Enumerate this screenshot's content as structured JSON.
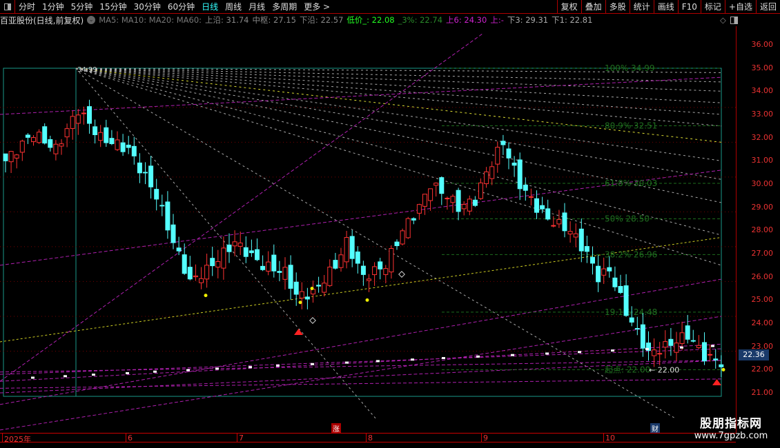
{
  "periods": [
    "分时",
    "1分钟",
    "5分钟",
    "15分钟",
    "30分钟",
    "60分钟",
    "日线",
    "周线",
    "月线",
    "多周期",
    "更多 >"
  ],
  "active_period": "日线",
  "right_buttons": [
    "复权",
    "叠加",
    "多股",
    "统计",
    "画线",
    "F10",
    "标记",
    "+自选",
    "返回"
  ],
  "info": {
    "stock": "百亚股份(日线,前复权)",
    "ma": "MA5: MA10: MA20: MA60:",
    "upper": "上沿: 31.74",
    "mid": "中枢: 27.15",
    "lower": "下沿: 22.57",
    "low_price": "低价_: 22.08",
    "pct3": "_3%: 22.74",
    "up6": "上6: 24.30",
    "up": "上:-",
    "down3": "下3: 29.31",
    "down1": "下1: 22.81"
  },
  "price_axis": [
    "36.00",
    "35.00",
    "34.00",
    "33.00",
    "32.00",
    "31.00",
    "30.00",
    "29.00",
    "28.00",
    "27.00",
    "26.00",
    "25.00",
    "24.00",
    "23.00",
    "22.00",
    "21.00"
  ],
  "current_price": "22.36",
  "fib": [
    {
      "label": "100%  34.99",
      "p": 34.99
    },
    {
      "label": "80.9%  32.51",
      "p": 32.51
    },
    {
      "label": "61.8%  30.03",
      "p": 30.03
    },
    {
      "label": "50%  28.50",
      "p": 28.5
    },
    {
      "label": "38.2%  26.96",
      "p": 26.96
    },
    {
      "label": "19.1%  24.48",
      "p": 24.48
    },
    {
      "label": "起点: 22.00",
      "p": 22.0
    }
  ],
  "high_label": "34.99",
  "start_arrow_label": "22.00",
  "months": [
    "2025年",
    "6",
    "7",
    "8",
    "9",
    "10"
  ],
  "markers": {
    "zhang": "涨",
    "cai": "财"
  },
  "logo": {
    "name": "股朋指标网",
    "url": "www.7gpzb.com"
  },
  "colors": {
    "up": "#ff3232",
    "down": "#54ffff",
    "fib": "#1e6e1e",
    "box": "#1a9a8a"
  },
  "price_anchors": [
    [
      0,
      31
    ],
    [
      5,
      32.2
    ],
    [
      9,
      31.5
    ],
    [
      13,
      33.2
    ],
    [
      17,
      32
    ],
    [
      22,
      31.5
    ],
    [
      27,
      29.5
    ],
    [
      30,
      27.5
    ],
    [
      33,
      25.8
    ],
    [
      36,
      26.3
    ],
    [
      41,
      27.5
    ],
    [
      46,
      26.5
    ],
    [
      50,
      26.2
    ],
    [
      52,
      25.2
    ],
    [
      55,
      25.3
    ],
    [
      59,
      26.5
    ],
    [
      61,
      27.5
    ],
    [
      64,
      26
    ],
    [
      68,
      26.5
    ],
    [
      71,
      28
    ],
    [
      74,
      29
    ],
    [
      76,
      30
    ],
    [
      79,
      29.5
    ],
    [
      81,
      29
    ],
    [
      84,
      29.3
    ],
    [
      86,
      30.5
    ],
    [
      89,
      31.8
    ],
    [
      92,
      30
    ],
    [
      95,
      29
    ],
    [
      97,
      28.5
    ],
    [
      101,
      28
    ],
    [
      104,
      27
    ],
    [
      106,
      26
    ],
    [
      108,
      26.3
    ],
    [
      111,
      24.5
    ],
    [
      115,
      22.7
    ],
    [
      118,
      23
    ],
    [
      122,
      23.5
    ],
    [
      125,
      22.6
    ],
    [
      128,
      22.3
    ]
  ]
}
